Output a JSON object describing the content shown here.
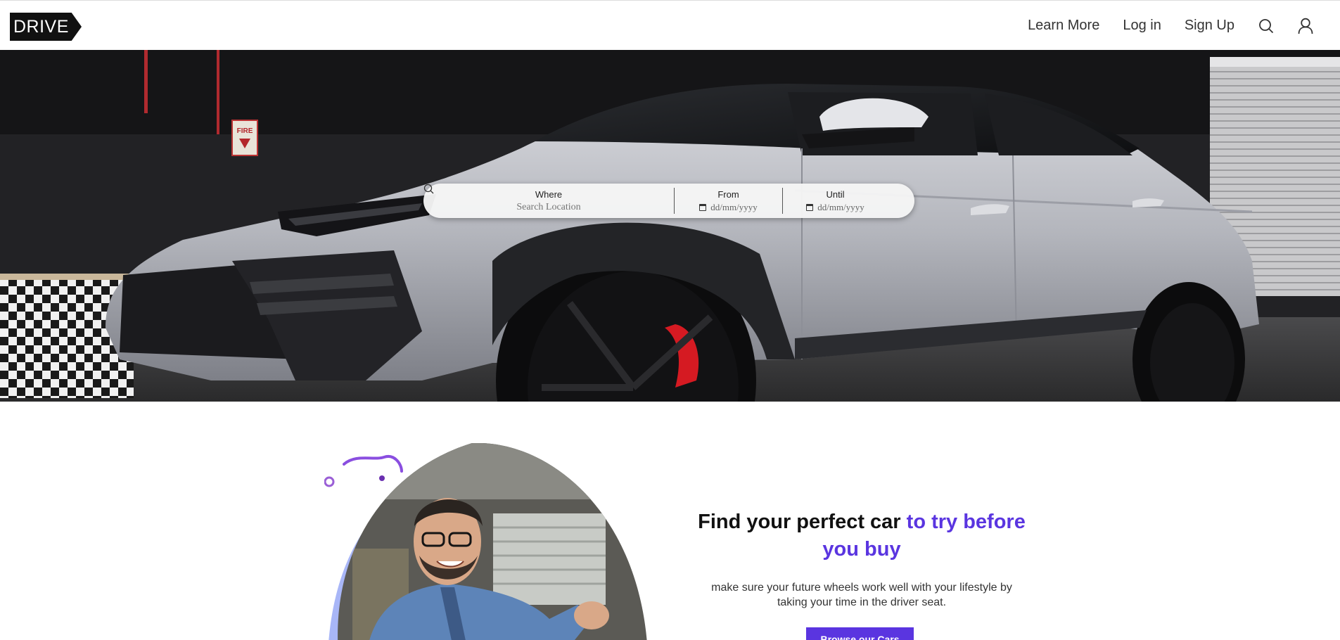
{
  "header": {
    "logo_text": "DRIVE",
    "nav": {
      "learn_more": "Learn More",
      "log_in": "Log in",
      "sign_up": "Sign Up"
    },
    "icons": [
      "search-icon",
      "user-icon"
    ]
  },
  "search_bar": {
    "where_label": "Where",
    "where_placeholder": "Search Location",
    "from_label": "From",
    "from_placeholder": "dd/mm/yyyy",
    "until_label": "Until",
    "until_placeholder": "dd/mm/yyyy",
    "submit_icon": "search-icon"
  },
  "hero": {
    "fire_sign": "FIRE"
  },
  "promo": {
    "title_plain": "Find your perfect car ",
    "title_accent": "to try before you buy",
    "subtitle": "make sure your future wheels work well with your lifestyle by taking your time in the driver seat.",
    "button_label": "Browse our Cars"
  },
  "colors": {
    "accent": "#5a35e0",
    "logo_bg": "#111111"
  }
}
